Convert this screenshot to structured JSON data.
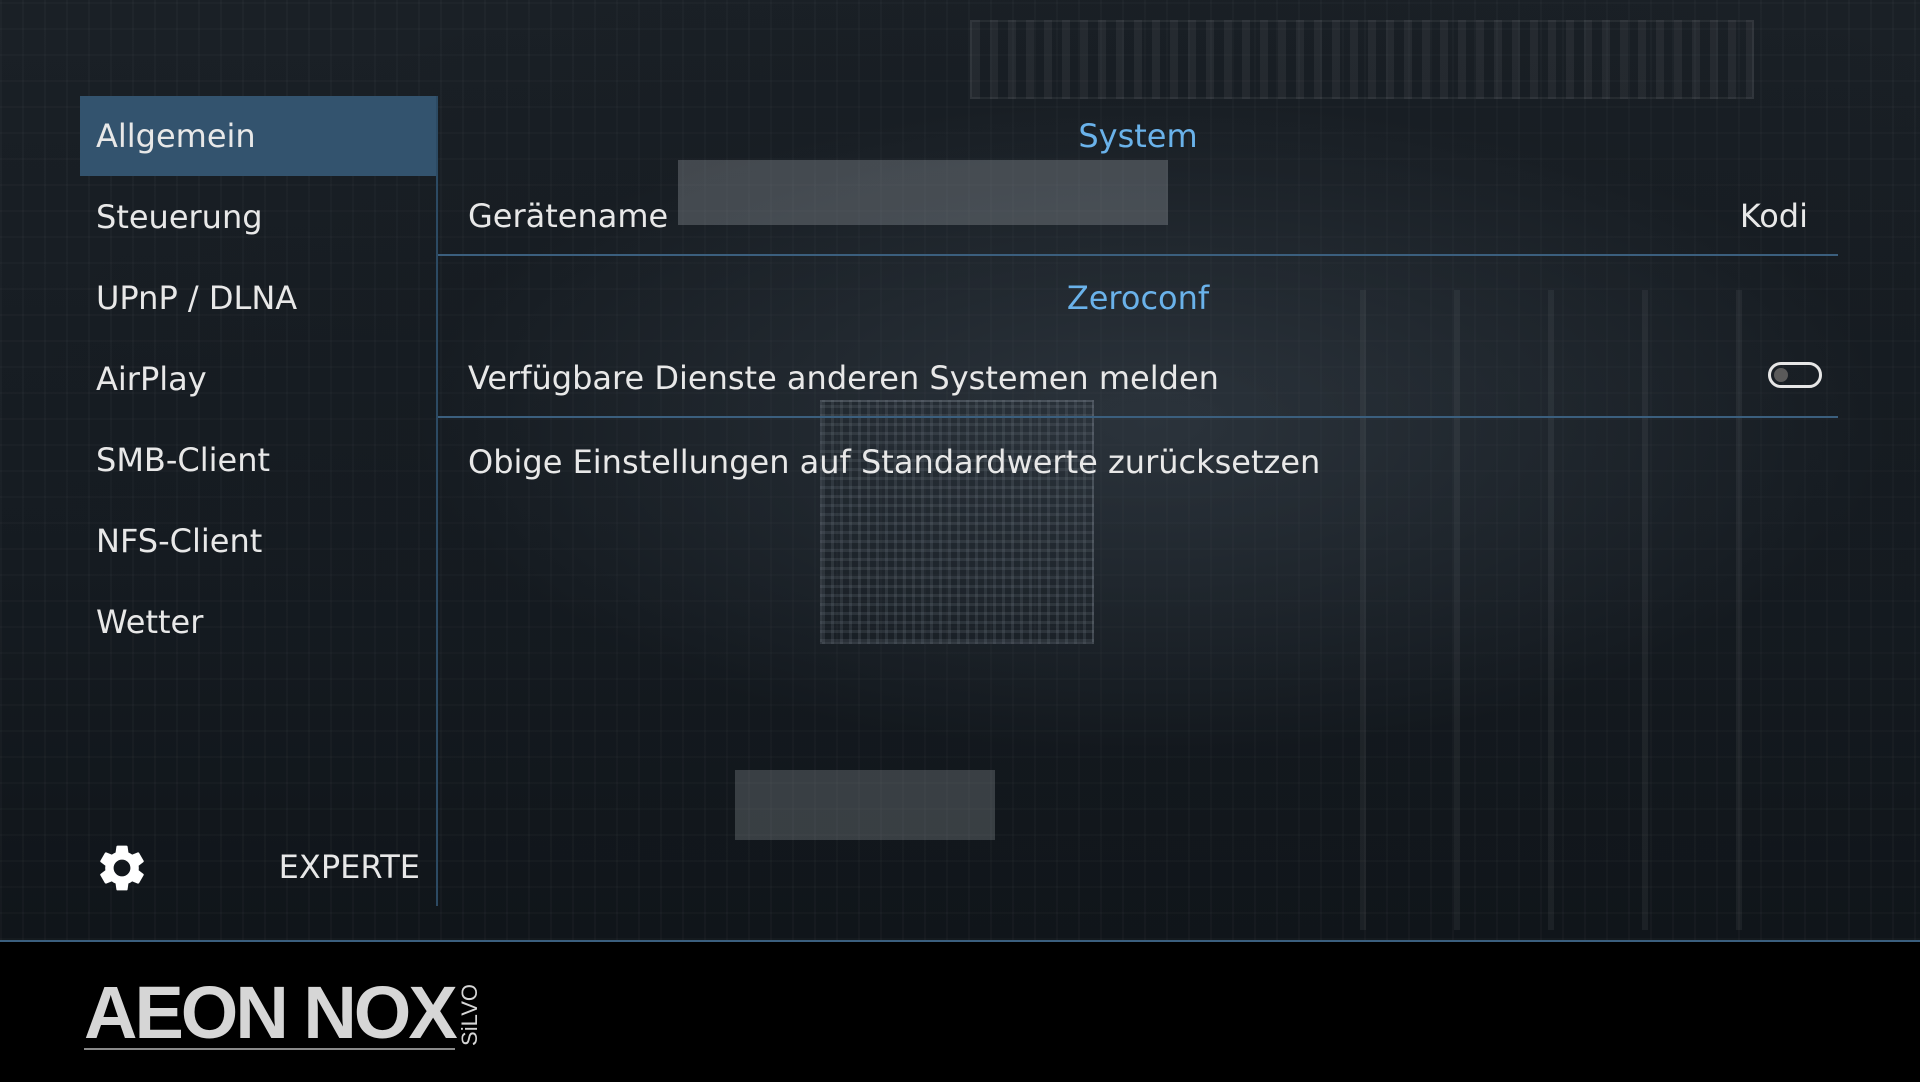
{
  "sidebar": {
    "items": [
      {
        "label": "Allgemein"
      },
      {
        "label": "Steuerung"
      },
      {
        "label": "UPnP / DLNA"
      },
      {
        "label": "AirPlay"
      },
      {
        "label": "SMB-Client"
      },
      {
        "label": "NFS-Client"
      },
      {
        "label": "Wetter"
      }
    ],
    "active_index": 0,
    "level_label": "EXPERTE",
    "level_icon": "gear-icon"
  },
  "main": {
    "sections": [
      {
        "header": "System"
      },
      {
        "header": "Zeroconf"
      }
    ],
    "settings": {
      "device_name_label": "Gerätename",
      "device_name_value": "Kodi",
      "announce_services_label": "Verfügbare Dienste anderen Systemen melden",
      "announce_services_enabled": false,
      "reset_label": "Obige Einstellungen auf Standardwerte zurücksetzen"
    }
  },
  "footer": {
    "logo_main": "AEON NOX",
    "logo_sub": "SiLVO"
  },
  "colors": {
    "accent": "#6ab2ea",
    "active_item": "#33536e",
    "separator": "#3b5f7e"
  }
}
